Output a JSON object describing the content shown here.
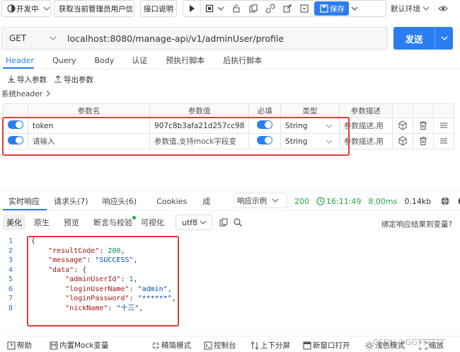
{
  "toolbar": {
    "env_status": "开发中",
    "api_name": "获取当前管理员用户信",
    "doc_button": "接口说明",
    "save_label": "保存",
    "env_select": "默认环境"
  },
  "request": {
    "method": "GET",
    "url": "localhost:8080/manage-api/v1/adminUser/profile",
    "send_label": "发送"
  },
  "req_tabs": [
    "Header",
    "Query",
    "Body",
    "认证",
    "预执行脚本",
    "后执行脚本"
  ],
  "header_actions": {
    "import": "导入参数",
    "export": "导出参数"
  },
  "system_header": "系统header",
  "param_table": {
    "columns": [
      "参数名",
      "参数值",
      "必填",
      "类型",
      "参数描述"
    ],
    "rows": [
      {
        "name": "token",
        "value": "907c8b3afa21d257cc98",
        "type": "String",
        "desc": "参数描述,用"
      },
      {
        "name": "请输入",
        "value": "参数值,支持mock字段变",
        "type": "String",
        "desc": "参数描述,用"
      }
    ]
  },
  "resp_tabs": {
    "items": [
      "实时响应",
      "请求头(7)",
      "响应头(6)",
      "Cookies",
      "成"
    ],
    "example": "响应示例",
    "status": "200",
    "time": "16:11:49",
    "duration": "8.00ms",
    "size": "0.14kb"
  },
  "view_tabs": {
    "items": [
      "美化",
      "原生",
      "预览",
      "断言与校验",
      "可视化"
    ],
    "encoding": "utf8",
    "bind_link": "绑定响应结果到变量?"
  },
  "code": {
    "line_numbers": [
      "1",
      "2",
      "3",
      "4",
      "5",
      "6",
      "7",
      "8"
    ],
    "l1": "{",
    "l2_key": "\"resultCode\"",
    "l2_val": "200",
    "l3_key": "\"message\"",
    "l3_val": "\"SUCCESS\"",
    "l4_key": "\"data\"",
    "l4_val": "{",
    "l5_key": "\"adminUserId\"",
    "l5_val": "1",
    "l6_key": "\"loginUserName\"",
    "l6_val": "\"admin\"",
    "l7_key": "\"loginPassword\"",
    "l7_val": "\"******\"",
    "l8_key": "\"nickName\"",
    "l8_val": "\"十三\""
  },
  "footer": {
    "help": "帮助",
    "mock": "内置Mock变量",
    "simple_mode": "精简模式",
    "console": "控制台",
    "split": "上下分屏",
    "new_window": "新窗口打开",
    "light_mode": "浅色模式",
    "zoom": "缩放"
  },
  "watermark": "CSDN @GGTTTTTT"
}
